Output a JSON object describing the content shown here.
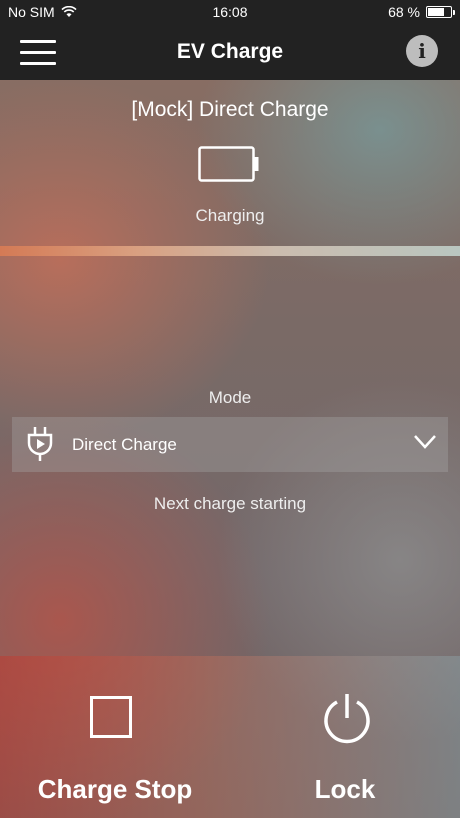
{
  "status_bar": {
    "carrier": "No SIM",
    "time": "16:08",
    "battery_percent": "68 %"
  },
  "nav": {
    "title": "EV Charge"
  },
  "charger": {
    "name": "[Mock] Direct Charge",
    "status": "Charging"
  },
  "mode": {
    "label": "Mode",
    "selected": "Direct Charge",
    "next_charge_text": "Next charge starting"
  },
  "actions": {
    "stop_label": "Charge Stop",
    "lock_label": "Lock"
  },
  "icons": {
    "menu": "hamburger-menu-icon",
    "info": "info-icon",
    "battery": "battery-outline-icon",
    "plug": "plug-icon",
    "dropdown": "chevron-down-icon",
    "stop": "stop-square-icon",
    "lock": "power-icon"
  },
  "colors": {
    "bar_background": "#222222",
    "info_button": "#bdbdbd"
  }
}
